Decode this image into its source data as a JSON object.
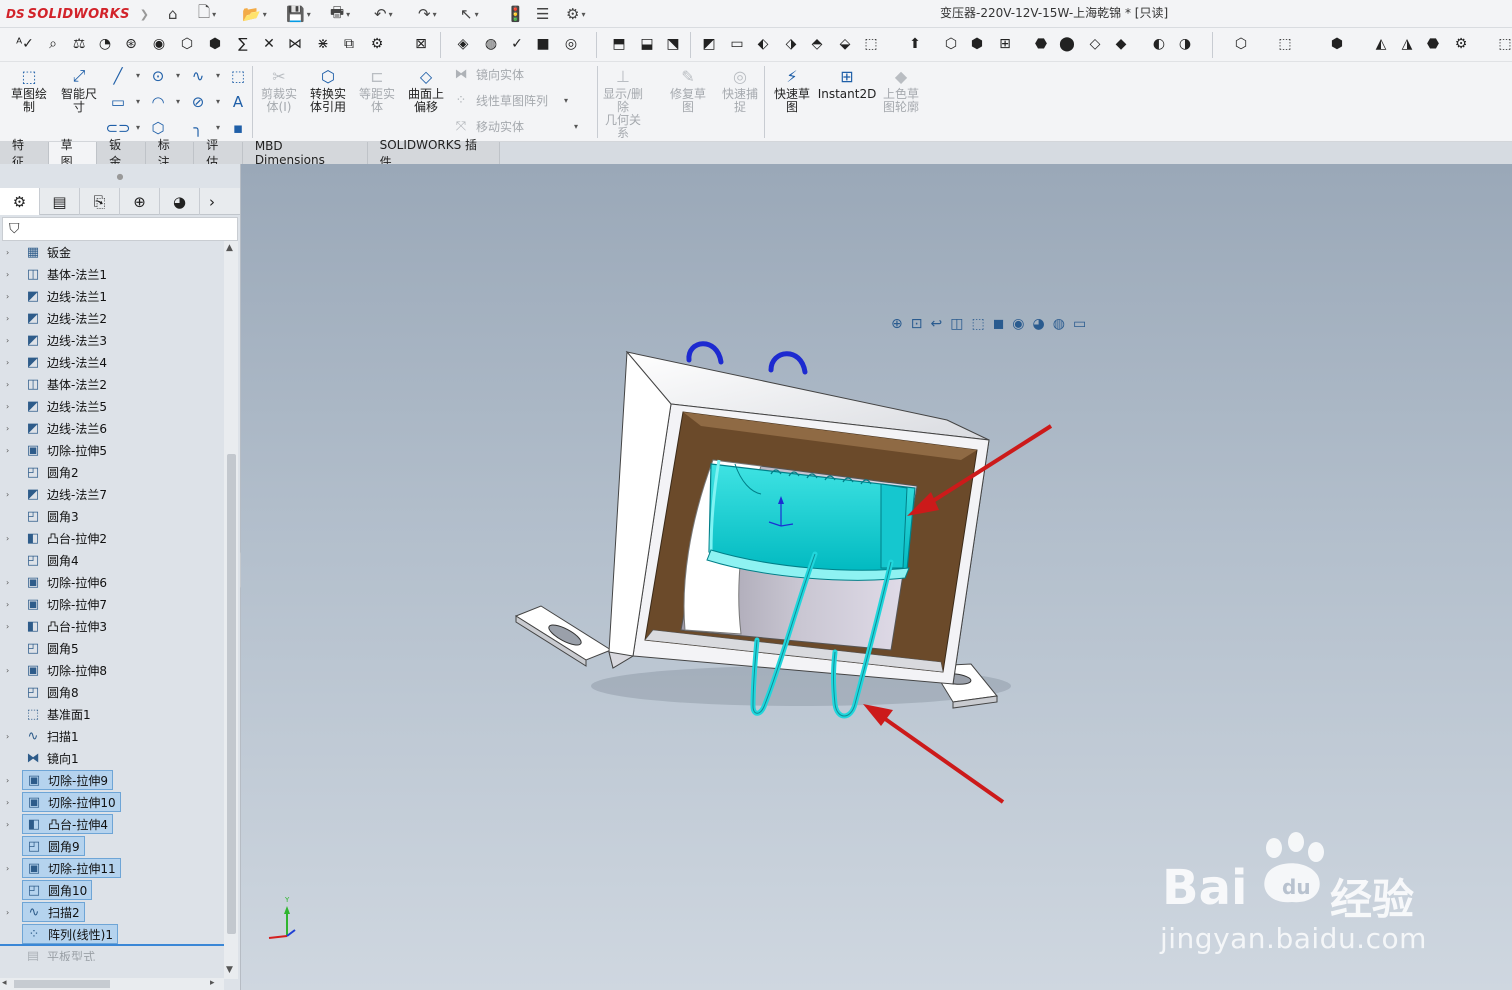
{
  "app": {
    "logo_text": "SOLIDWORKS",
    "logo_mark": "DS",
    "document_title": "变压器-220V-12V-15W-上海乾锦 * [只读]"
  },
  "quick_access": [
    {
      "name": "home-icon",
      "glyph": "⌂"
    },
    {
      "name": "new-document-icon",
      "glyph": "🗋"
    },
    {
      "name": "open-icon",
      "glyph": "📂"
    },
    {
      "name": "save-icon",
      "glyph": "💾"
    },
    {
      "name": "print-icon",
      "glyph": "🖶"
    },
    {
      "name": "undo-icon",
      "glyph": "↶"
    },
    {
      "name": "redo-icon",
      "glyph": "↷"
    },
    {
      "name": "select-icon",
      "glyph": "↖"
    },
    {
      "name": "rebuild-icon",
      "glyph": "🚦"
    },
    {
      "name": "file-properties-icon",
      "glyph": "☰"
    },
    {
      "name": "options-icon",
      "glyph": "⚙"
    }
  ],
  "command_manager": {
    "sketch_buttons": [
      {
        "label": "草图绘\n制",
        "glyph": "⬚",
        "disabled": false
      },
      {
        "label": "智能尺\n寸",
        "glyph": "⤢",
        "disabled": false
      }
    ],
    "feature_buttons": [
      {
        "label": "剪裁实\n体(I)",
        "glyph": "✂",
        "disabled": true
      },
      {
        "label": "转换实\n体引用",
        "glyph": "⬡",
        "disabled": false
      },
      {
        "label": "等距实\n体",
        "glyph": "⊏",
        "disabled": true
      },
      {
        "label": "曲面上\n偏移",
        "glyph": "◇",
        "disabled": false
      }
    ],
    "small_buttons": [
      {
        "label": "镜向实体",
        "glyph": "⧓"
      },
      {
        "label": "线性草图阵列",
        "glyph": "⁘"
      },
      {
        "label": "移动实体",
        "glyph": "⤧"
      }
    ],
    "relation_buttons": [
      {
        "label": "显示/删除\n几何关系",
        "glyph": "⊥",
        "disabled": true
      },
      {
        "label": "修复草\n图",
        "glyph": "✎",
        "disabled": true
      },
      {
        "label": "快速捕\n捉",
        "glyph": "◎",
        "disabled": true
      }
    ],
    "extra_buttons": [
      {
        "label": "快速草\n图",
        "glyph": "⚡",
        "disabled": false
      },
      {
        "label": "Instant2D",
        "glyph": "⊞",
        "disabled": false
      },
      {
        "label": "上色草\n图轮廓",
        "glyph": "◆",
        "disabled": true
      }
    ]
  },
  "tabs": [
    {
      "label": "特征",
      "active": false
    },
    {
      "label": "草图",
      "active": true
    },
    {
      "label": "钣金",
      "active": false
    },
    {
      "label": "标注",
      "active": false
    },
    {
      "label": "评估",
      "active": false
    },
    {
      "label": "MBD Dimensions",
      "active": false
    },
    {
      "label": "SOLIDWORKS 插件",
      "active": false
    }
  ],
  "panel_tabs": [
    {
      "name": "feature-manager-tab",
      "glyph": "⚙",
      "active": true
    },
    {
      "name": "property-manager-tab",
      "glyph": "▤",
      "active": false
    },
    {
      "name": "configuration-manager-tab",
      "glyph": "⎘",
      "active": false
    },
    {
      "name": "dimxpert-manager-tab",
      "glyph": "⊕",
      "active": false
    },
    {
      "name": "display-manager-tab",
      "glyph": "◕",
      "active": false
    }
  ],
  "feature_tree": [
    {
      "label": "钣金",
      "expand": true,
      "glyph": "▦",
      "selected": false
    },
    {
      "label": "基体-法兰1",
      "expand": true,
      "glyph": "◫",
      "selected": false
    },
    {
      "label": "边线-法兰1",
      "expand": true,
      "glyph": "◩",
      "selected": false
    },
    {
      "label": "边线-法兰2",
      "expand": true,
      "glyph": "◩",
      "selected": false
    },
    {
      "label": "边线-法兰3",
      "expand": true,
      "glyph": "◩",
      "selected": false
    },
    {
      "label": "边线-法兰4",
      "expand": true,
      "glyph": "◩",
      "selected": false
    },
    {
      "label": "基体-法兰2",
      "expand": true,
      "glyph": "◫",
      "selected": false
    },
    {
      "label": "边线-法兰5",
      "expand": true,
      "glyph": "◩",
      "selected": false
    },
    {
      "label": "边线-法兰6",
      "expand": true,
      "glyph": "◩",
      "selected": false
    },
    {
      "label": "切除-拉伸5",
      "expand": true,
      "glyph": "▣",
      "selected": false
    },
    {
      "label": "圆角2",
      "expand": false,
      "glyph": "◰",
      "selected": false
    },
    {
      "label": "边线-法兰7",
      "expand": true,
      "glyph": "◩",
      "selected": false
    },
    {
      "label": "圆角3",
      "expand": false,
      "glyph": "◰",
      "selected": false
    },
    {
      "label": "凸台-拉伸2",
      "expand": true,
      "glyph": "◧",
      "selected": false
    },
    {
      "label": "圆角4",
      "expand": false,
      "glyph": "◰",
      "selected": false
    },
    {
      "label": "切除-拉伸6",
      "expand": true,
      "glyph": "▣",
      "selected": false
    },
    {
      "label": "切除-拉伸7",
      "expand": true,
      "glyph": "▣",
      "selected": false
    },
    {
      "label": "凸台-拉伸3",
      "expand": true,
      "glyph": "◧",
      "selected": false
    },
    {
      "label": "圆角5",
      "expand": false,
      "glyph": "◰",
      "selected": false
    },
    {
      "label": "切除-拉伸8",
      "expand": true,
      "glyph": "▣",
      "selected": false
    },
    {
      "label": "圆角8",
      "expand": false,
      "glyph": "◰",
      "selected": false
    },
    {
      "label": "基准面1",
      "expand": false,
      "glyph": "⬚",
      "selected": false
    },
    {
      "label": "扫描1",
      "expand": true,
      "glyph": "∿",
      "selected": false
    },
    {
      "label": "镜向1",
      "expand": false,
      "glyph": "⧓",
      "selected": false
    },
    {
      "label": "切除-拉伸9",
      "expand": true,
      "glyph": "▣",
      "selected": true
    },
    {
      "label": "切除-拉伸10",
      "expand": true,
      "glyph": "▣",
      "selected": true
    },
    {
      "label": "凸台-拉伸4",
      "expand": true,
      "glyph": "◧",
      "selected": true
    },
    {
      "label": "圆角9",
      "expand": false,
      "glyph": "◰",
      "selected": true
    },
    {
      "label": "切除-拉伸11",
      "expand": true,
      "glyph": "▣",
      "selected": true
    },
    {
      "label": "圆角10",
      "expand": false,
      "glyph": "◰",
      "selected": true
    },
    {
      "label": "扫描2",
      "expand": true,
      "glyph": "∿",
      "selected": true
    },
    {
      "label": "阵列(线性)1",
      "expand": false,
      "glyph": "⁘",
      "selected": true
    },
    {
      "label": "平板型式",
      "expand": false,
      "glyph": "▤",
      "selected": false,
      "dim": true
    }
  ],
  "heads_up_toolbar": [
    {
      "name": "zoom-to-fit-icon",
      "glyph": "⊕"
    },
    {
      "name": "zoom-to-area-icon",
      "glyph": "⊡"
    },
    {
      "name": "previous-view-icon",
      "glyph": "↩"
    },
    {
      "name": "section-view-icon",
      "glyph": "◫"
    },
    {
      "name": "view-orientation-icon",
      "glyph": "⬚"
    },
    {
      "name": "display-style-icon",
      "glyph": "◼"
    },
    {
      "name": "hide-show-items-icon",
      "glyph": "◉"
    },
    {
      "name": "edit-appearance-icon",
      "glyph": "◕"
    },
    {
      "name": "apply-scene-icon",
      "glyph": "◍"
    },
    {
      "name": "view-settings-icon",
      "glyph": "▭"
    }
  ],
  "watermark": {
    "brand": "Bai",
    "brand_suffix": "经验",
    "site": "jingyan.baidu.com"
  },
  "colors": {
    "selection": "#00d2d2",
    "annotation_arrow": "#cc1a1a",
    "accent": "#1f5fa8"
  }
}
